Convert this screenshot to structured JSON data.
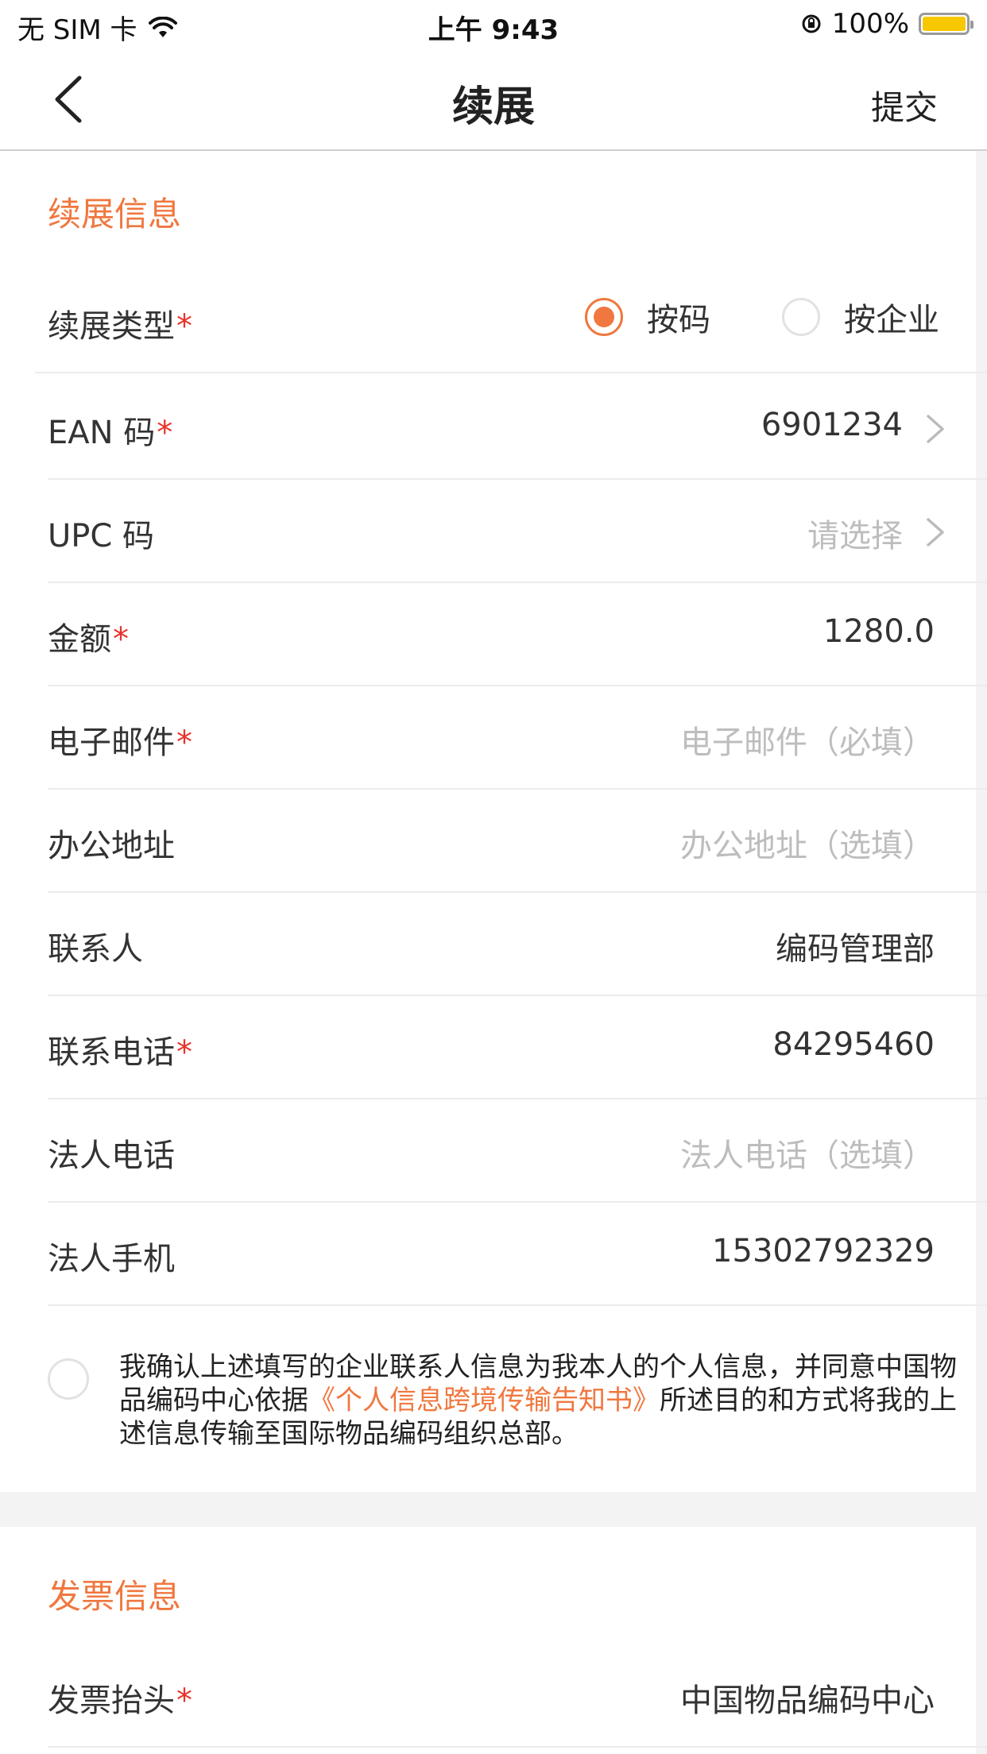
{
  "status": {
    "carrier": "无 SIM 卡",
    "time": "上午 9:43",
    "battery": "100%",
    "battery_level": 1.0
  },
  "nav": {
    "title": "续展",
    "submit": "提交"
  },
  "renewal": {
    "section_title": "续展信息",
    "type_label": "续展类型",
    "type_options": [
      "按码",
      "按企业"
    ],
    "type_selected": "按码",
    "ean_label": "EAN 码",
    "ean_value": "6901234",
    "upc_label": "UPC 码",
    "upc_placeholder": "请选择",
    "amount_label": "金额",
    "amount_value": "1280.0",
    "email_label": "电子邮件",
    "email_placeholder": "电子邮件（必填）",
    "address_label": "办公地址",
    "address_placeholder": "办公地址（选填）",
    "contact_label": "联系人",
    "contact_value": "编码管理部",
    "phone_label": "联系电话",
    "phone_value": "84295460",
    "legal_phone_label": "法人电话",
    "legal_phone_placeholder": "法人电话（选填）",
    "legal_mobile_label": "法人手机",
    "legal_mobile_value": "15302792329"
  },
  "consent": {
    "text_before": "我确认上述填写的企业联系人信息为我本人的个人信息，并同意中国物品编码中心依据",
    "link_text": "《个人信息跨境传输告知书》",
    "text_after": "所述目的和方式将我的上述信息传输至国际物品编码组织总部。"
  },
  "invoice": {
    "section_title": "发票信息",
    "title_label": "发票抬头",
    "title_value": "中国物品编码中心"
  },
  "required_mark": "*",
  "colors": {
    "accent": "#f0773f",
    "required": "#e8332a",
    "placeholder": "#bdbdbd"
  }
}
